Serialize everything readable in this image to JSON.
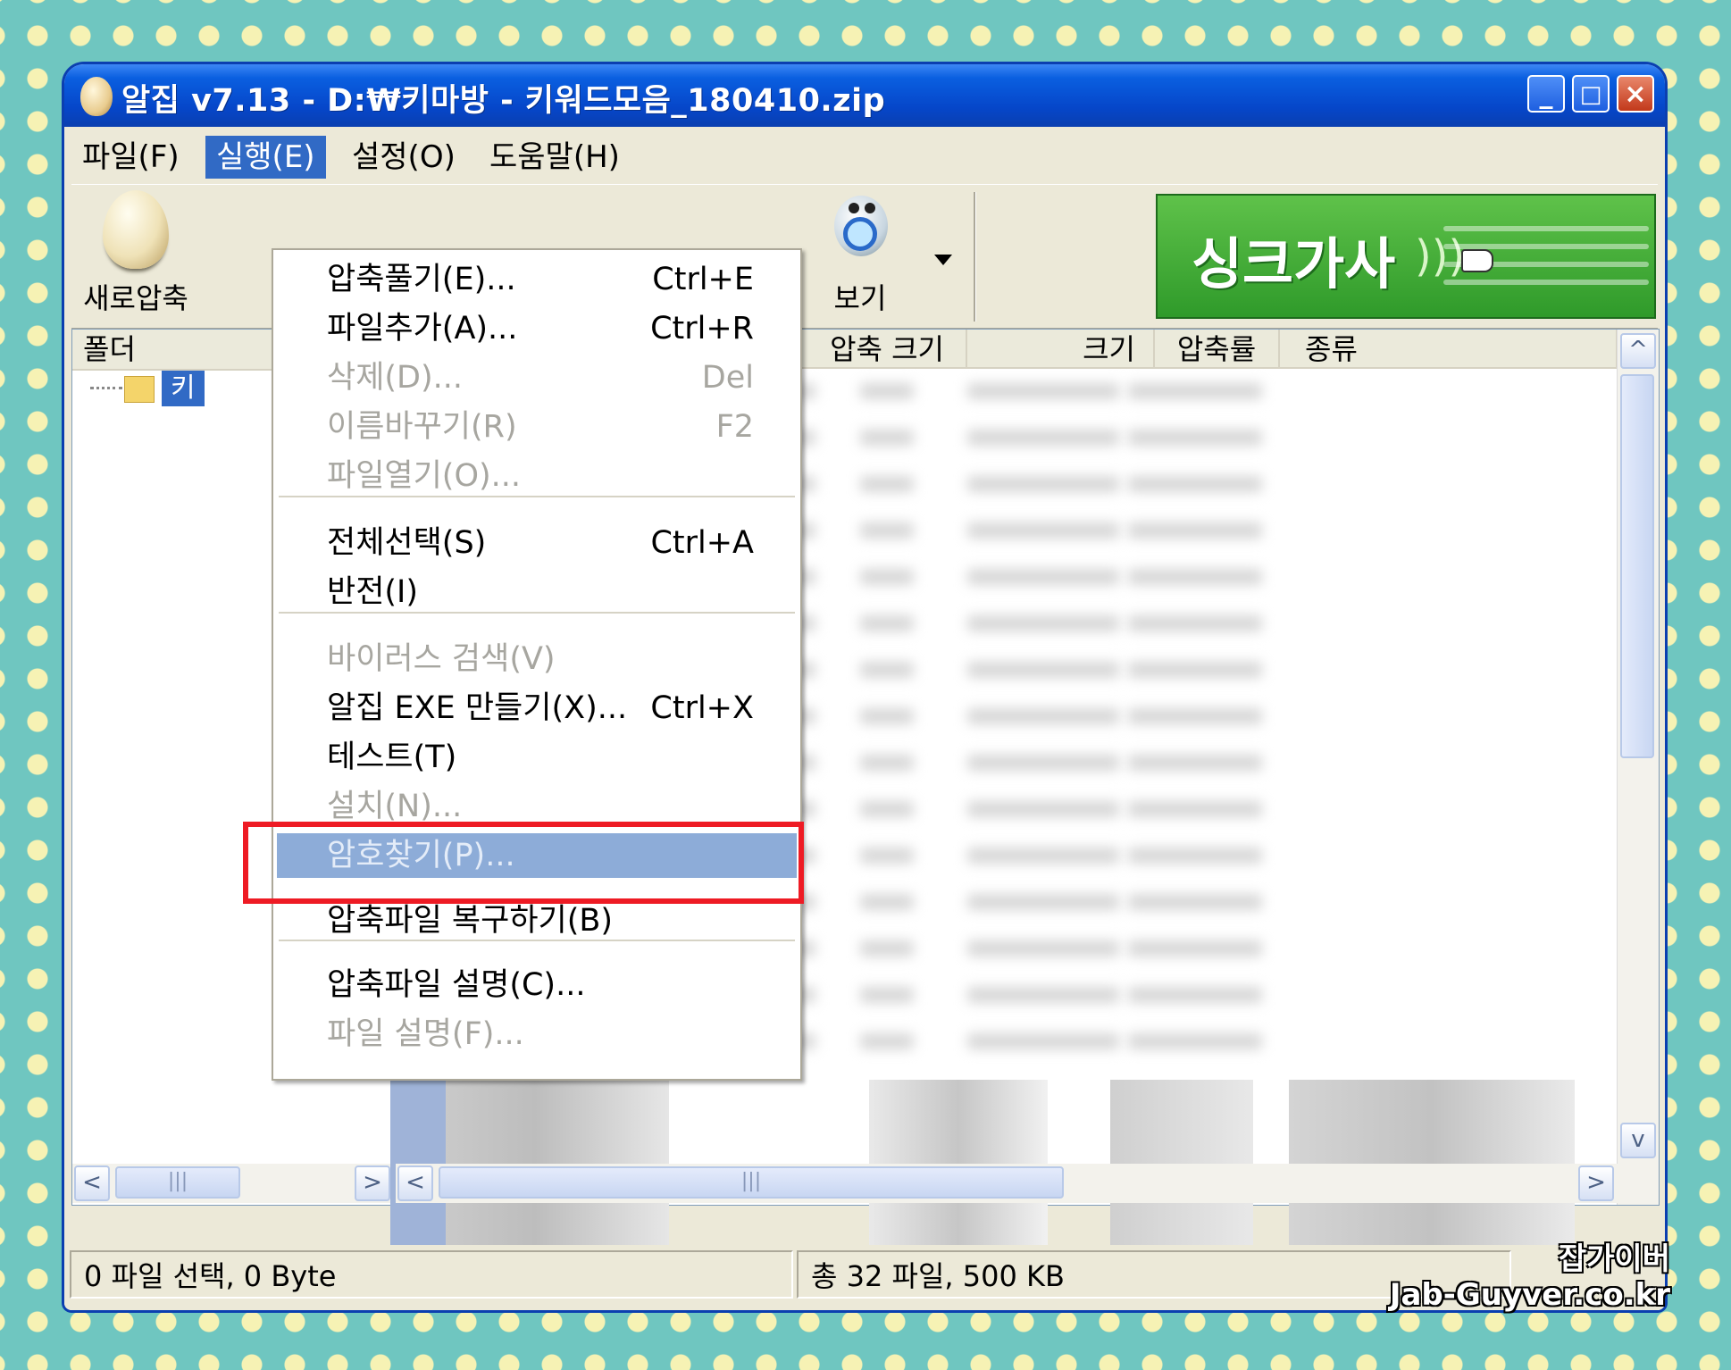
{
  "window": {
    "title": "알집 v7.13 - D:₩키마방 - 키워드모음_180410.zip",
    "minimize": "_",
    "maximize": "□",
    "close": "×"
  },
  "menubar": {
    "items": [
      "파일(F)",
      "실행(E)",
      "설정(O)",
      "도움말(H)"
    ],
    "active": "실행(E)"
  },
  "toolbar": {
    "new_archive_label": "새로압축",
    "view_label": "보기",
    "banner_text": "싱크가사"
  },
  "left_pane": {
    "header": "폴더",
    "tree_item": "키"
  },
  "columns": [
    "압축 크기",
    "크기",
    "압축률",
    "종류"
  ],
  "dropdown": {
    "items": [
      {
        "label": "압축풀기(E)...",
        "shortcut": "Ctrl+E",
        "disabled": false
      },
      {
        "label": "파일추가(A)...",
        "shortcut": "Ctrl+R",
        "disabled": false
      },
      {
        "label": "삭제(D)...",
        "shortcut": "Del",
        "disabled": true
      },
      {
        "label": "이름바꾸기(R)",
        "shortcut": "F2",
        "disabled": true
      },
      {
        "label": "파일열기(O)...",
        "shortcut": "",
        "disabled": true
      },
      {
        "label": "전체선택(S)",
        "shortcut": "Ctrl+A",
        "disabled": false
      },
      {
        "label": "반전(I)",
        "shortcut": "",
        "disabled": false
      },
      {
        "label": "바이러스 검색(V)",
        "shortcut": "",
        "disabled": true
      },
      {
        "label": "알집 EXE 만들기(X)...",
        "shortcut": "Ctrl+X",
        "disabled": false
      },
      {
        "label": "테스트(T)",
        "shortcut": "",
        "disabled": false
      },
      {
        "label": "설치(N)...",
        "shortcut": "",
        "disabled": true
      },
      {
        "label": "암호찾기(P)...",
        "shortcut": "",
        "disabled": false,
        "highlighted": true
      },
      {
        "label": "압축파일 복구하기(B)",
        "shortcut": "",
        "disabled": false
      },
      {
        "label": "압축파일 설명(C)...",
        "shortcut": "",
        "disabled": false
      },
      {
        "label": "파일 설명(F)...",
        "shortcut": "",
        "disabled": true
      }
    ]
  },
  "statusbar": {
    "selection": "0 파일 선택,  0 Byte",
    "total": "총 32 파일,  500 KB"
  },
  "watermark": {
    "line1": "잡가이버",
    "line2": "Jab-Guyver.co.kr"
  },
  "colors": {
    "highlight_box": "#ee1b24",
    "menu_active": "#316ac5",
    "titlebar": "#0646c9"
  }
}
